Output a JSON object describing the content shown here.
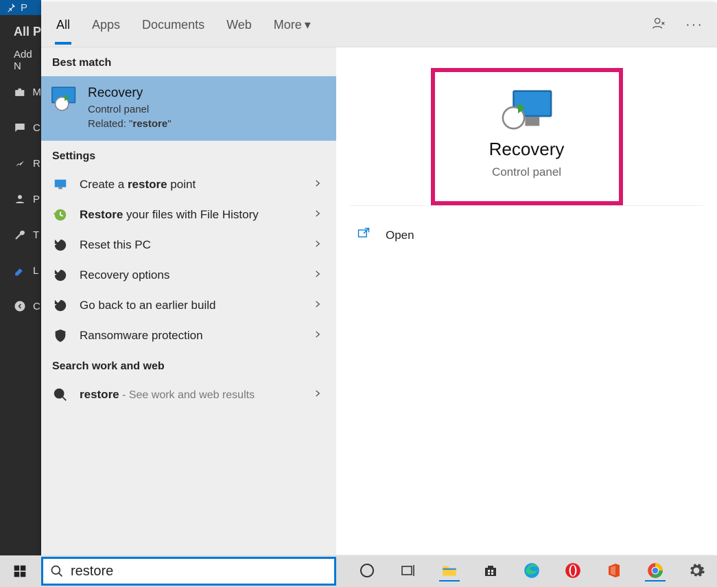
{
  "bg": {
    "pin_label": "P",
    "all_label": "All P",
    "add_label": "Add N",
    "rows": [
      "M",
      "C",
      "R",
      "P",
      "T",
      "L",
      "C"
    ]
  },
  "tabs": {
    "all": "All",
    "apps": "Apps",
    "documents": "Documents",
    "web": "Web",
    "more": "More"
  },
  "sections": {
    "best_match": "Best match",
    "settings": "Settings",
    "search_web": "Search work and web"
  },
  "bestmatch": {
    "title": "Recovery",
    "subtitle": "Control panel",
    "related_prefix": "Related: \"",
    "related_bold": "restore",
    "related_suffix": "\""
  },
  "settings_items": [
    {
      "pre": "Create a ",
      "bold": "restore",
      "post": " point",
      "type": "monitor"
    },
    {
      "pre": "",
      "bold": "Restore",
      "post": " your files with File History",
      "type": "history"
    },
    {
      "pre": "Reset this PC",
      "bold": "",
      "post": "",
      "type": "recovery"
    },
    {
      "pre": "Recovery options",
      "bold": "",
      "post": "",
      "type": "recovery"
    },
    {
      "pre": "Go back to an earlier build",
      "bold": "",
      "post": "",
      "type": "recovery"
    },
    {
      "pre": "Ransomware protection",
      "bold": "",
      "post": "",
      "type": "shield"
    }
  ],
  "webitem": {
    "bold": "restore",
    "sub": " - See work and web results"
  },
  "preview": {
    "title": "Recovery",
    "subtitle": "Control panel",
    "open": "Open"
  },
  "search": {
    "value": "restore"
  }
}
